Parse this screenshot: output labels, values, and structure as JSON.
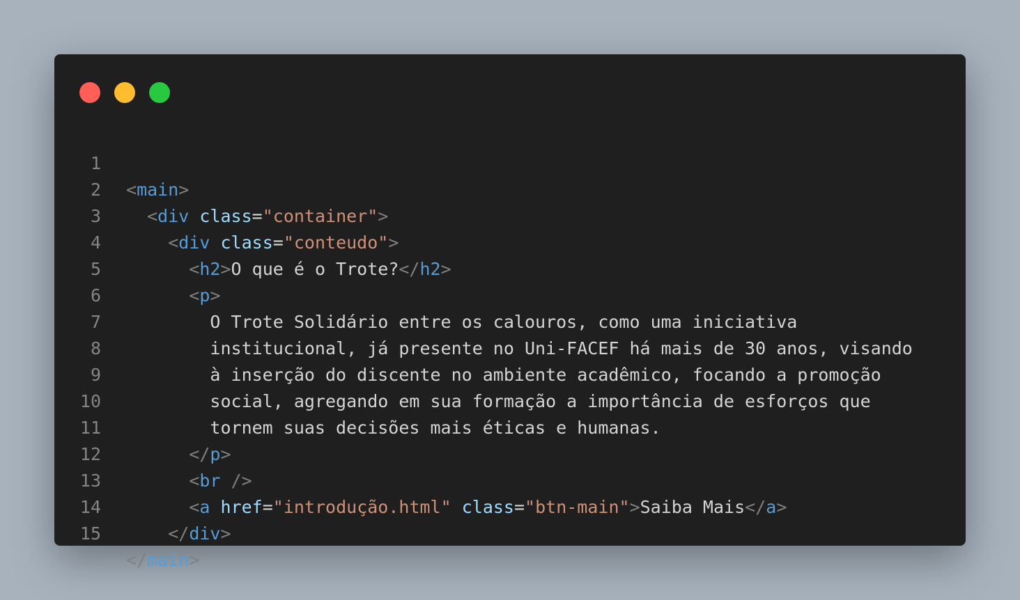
{
  "window": {
    "controls": {
      "close": "#ff5f57",
      "minimize": "#febc2e",
      "maximize": "#28c840"
    }
  },
  "code": {
    "lines": [
      {
        "n": "1"
      },
      {
        "n": "2"
      },
      {
        "n": "3"
      },
      {
        "n": "4"
      },
      {
        "n": "5"
      },
      {
        "n": "6"
      },
      {
        "n": "7"
      },
      {
        "n": "8"
      },
      {
        "n": "9"
      },
      {
        "n": "10"
      },
      {
        "n": "11"
      },
      {
        "n": "12"
      },
      {
        "n": "13"
      },
      {
        "n": "14"
      },
      {
        "n": "15"
      }
    ],
    "tokens": {
      "main": "main",
      "div": "div",
      "h2": "h2",
      "p": "p",
      "br": "br",
      "a": "a",
      "class": "class",
      "href": "href",
      "container": "\"container\"",
      "conteudo": "\"conteudo\"",
      "href_value": "\"introdução.html\"",
      "btn_main": "\"btn-main\"",
      "h2_text": "O que é o Trote?",
      "p_line_1": "O Trote Solidário entre os calouros, como uma iniciativa",
      "p_line_2": "institucional, já presente no Uni-FACEF há mais de 30 anos, visando",
      "p_line_3": "à inserção do discente no ambiente acadêmico, focando a promoção",
      "p_line_4": "social, agregando em sua formação a importância de esforços que",
      "p_line_5": "tornem suas decisões mais éticas e humanas.",
      "a_text": "Saiba Mais"
    }
  }
}
